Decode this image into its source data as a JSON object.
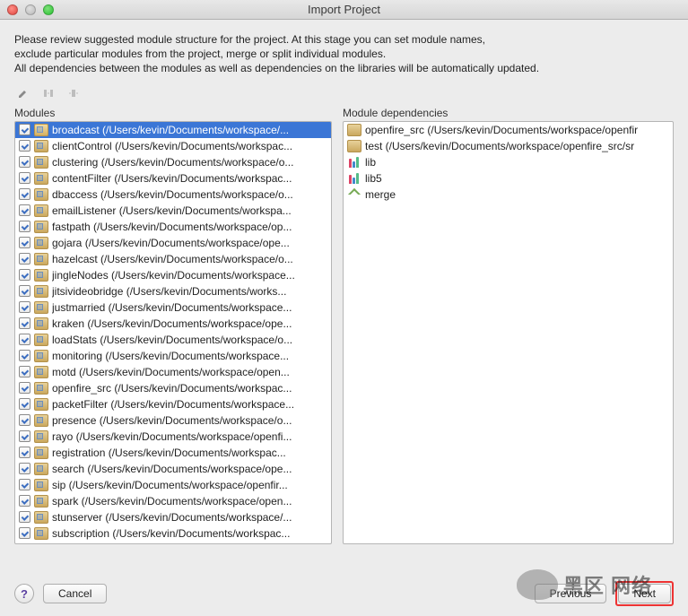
{
  "window": {
    "title": "Import Project"
  },
  "intro": {
    "line1": "Please review suggested module structure for the project. At this stage you can set module names,",
    "line2": "exclude particular modules from the project, merge or split individual modules.",
    "line3": "All dependencies between the modules as well as dependencies on the libraries will be automatically updated."
  },
  "labels": {
    "modules": "Modules",
    "dependencies": "Module dependencies"
  },
  "modules": [
    {
      "name": "broadcast (/Users/kevin/Documents/workspace/...",
      "selected": true
    },
    {
      "name": "clientControl (/Users/kevin/Documents/workspac..."
    },
    {
      "name": "clustering (/Users/kevin/Documents/workspace/o..."
    },
    {
      "name": "contentFilter (/Users/kevin/Documents/workspac..."
    },
    {
      "name": "dbaccess (/Users/kevin/Documents/workspace/o..."
    },
    {
      "name": "emailListener (/Users/kevin/Documents/workspa..."
    },
    {
      "name": "fastpath (/Users/kevin/Documents/workspace/op..."
    },
    {
      "name": "gojara (/Users/kevin/Documents/workspace/ope..."
    },
    {
      "name": "hazelcast (/Users/kevin/Documents/workspace/o..."
    },
    {
      "name": "jingleNodes (/Users/kevin/Documents/workspace..."
    },
    {
      "name": "jitsivideobridge (/Users/kevin/Documents/works..."
    },
    {
      "name": "justmarried (/Users/kevin/Documents/workspace..."
    },
    {
      "name": "kraken (/Users/kevin/Documents/workspace/ope..."
    },
    {
      "name": "loadStats (/Users/kevin/Documents/workspace/o..."
    },
    {
      "name": "monitoring (/Users/kevin/Documents/workspace..."
    },
    {
      "name": "motd (/Users/kevin/Documents/workspace/open..."
    },
    {
      "name": "openfire_src (/Users/kevin/Documents/workspac..."
    },
    {
      "name": "packetFilter (/Users/kevin/Documents/workspace..."
    },
    {
      "name": "presence (/Users/kevin/Documents/workspace/o..."
    },
    {
      "name": "rayo (/Users/kevin/Documents/workspace/openfi..."
    },
    {
      "name": "registration (/Users/kevin/Documents/workspac..."
    },
    {
      "name": "search (/Users/kevin/Documents/workspace/ope..."
    },
    {
      "name": "sip (/Users/kevin/Documents/workspace/openfir..."
    },
    {
      "name": "spark (/Users/kevin/Documents/workspace/open..."
    },
    {
      "name": "stunserver (/Users/kevin/Documents/workspace/..."
    },
    {
      "name": "subscription (/Users/kevin/Documents/workspac..."
    }
  ],
  "dependencies": [
    {
      "type": "folder",
      "name": "openfire_src (/Users/kevin/Documents/workspace/openfir"
    },
    {
      "type": "folder",
      "name": "test (/Users/kevin/Documents/workspace/openfire_src/sr"
    },
    {
      "type": "lib",
      "name": "lib"
    },
    {
      "type": "lib",
      "name": "lib5"
    },
    {
      "type": "merge",
      "name": "merge"
    }
  ],
  "buttons": {
    "help": "?",
    "cancel": "Cancel",
    "previous": "Previous",
    "next": "Next"
  },
  "watermark": "黑区 网络"
}
